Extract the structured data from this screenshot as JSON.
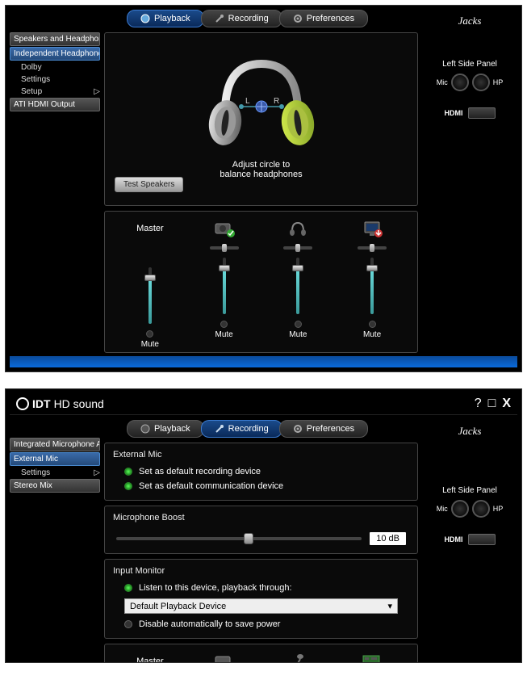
{
  "window1": {
    "tabs": {
      "playback": "Playback",
      "recording": "Recording",
      "preferences": "Preferences",
      "active": 0
    },
    "sidebar": {
      "items": [
        {
          "label": "Speakers and Headphon"
        },
        {
          "label": "Independent Headphone"
        }
      ],
      "subs": [
        {
          "label": "Dolby"
        },
        {
          "label": "Settings"
        },
        {
          "label": "Setup",
          "arrow": "▷"
        }
      ],
      "bottom": {
        "label": "ATI HDMI Output"
      }
    },
    "balance": {
      "left": "L",
      "right": "R",
      "line1": "Adjust circle to",
      "line2": "balance headphones"
    },
    "test_button": "Test Speakers",
    "mixer": {
      "master_label": "Master",
      "mute_label": "Mute",
      "channels": [
        {
          "fill": 82
        },
        {
          "fill": 82
        },
        {
          "fill": 82
        },
        {
          "fill": 82
        }
      ]
    },
    "jacks": {
      "title": "Jacks",
      "panel": "Left Side Panel",
      "mic": "Mic",
      "hp": "HP",
      "hdmi": "HDMI"
    }
  },
  "window2": {
    "brand_prefix": "IDT",
    "brand_title": "HD sound",
    "tabs": {
      "playback": "Playback",
      "recording": "Recording",
      "preferences": "Preferences",
      "active": 1
    },
    "sidebar": {
      "items": [
        {
          "label": "Integrated Microphone A"
        },
        {
          "label": "External Mic"
        }
      ],
      "subs": [
        {
          "label": "Settings",
          "arrow": "▷"
        }
      ],
      "bottom": {
        "label": "Stereo Mix"
      }
    },
    "ext_mic": {
      "title": "External Mic",
      "opt1": "Set as default recording device",
      "opt2": "Set as default communication device"
    },
    "boost": {
      "title": "Microphone Boost",
      "value": "10 dB",
      "pos": 52
    },
    "monitor": {
      "title": "Input Monitor",
      "listen": "Listen to this device, playback through:",
      "device": "Default Playback Device",
      "disable": "Disable automatically to save power"
    },
    "mixer": {
      "master_label": "Master"
    },
    "jacks": {
      "title": "Jacks",
      "panel": "Left Side Panel",
      "mic": "Mic",
      "hp": "HP",
      "hdmi": "HDMI"
    },
    "help": "?"
  }
}
